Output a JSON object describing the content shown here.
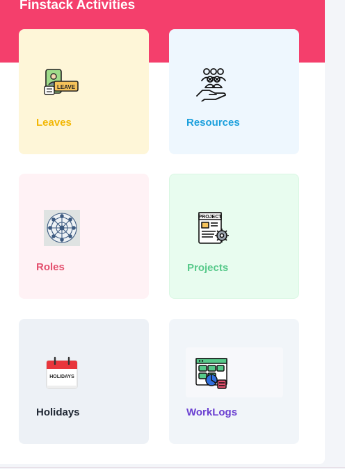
{
  "header": {
    "title": "Finstack Activities"
  },
  "cards": [
    {
      "label": "Leaves",
      "icon": "leave-certificate-icon",
      "badge": "LEAVE",
      "color": "#f2b705"
    },
    {
      "label": "Resources",
      "icon": "people-in-hand-icon",
      "color": "#1a9fdc"
    },
    {
      "label": "Roles",
      "icon": "network-circle-icon",
      "color": "#e4506e"
    },
    {
      "label": "Projects",
      "icon": "project-document-icon",
      "badge": "PROJECT",
      "color": "#57c98a"
    },
    {
      "label": "Holidays",
      "icon": "holidays-calendar-icon",
      "badge": "HOLIDAYS",
      "color": "#1f2733"
    },
    {
      "label": "WorkLogs",
      "icon": "worklogs-dashboard-icon",
      "color": "#6a3fd1"
    }
  ],
  "colors": {
    "banner": "#f43f6c",
    "panel": "#ffffff"
  }
}
